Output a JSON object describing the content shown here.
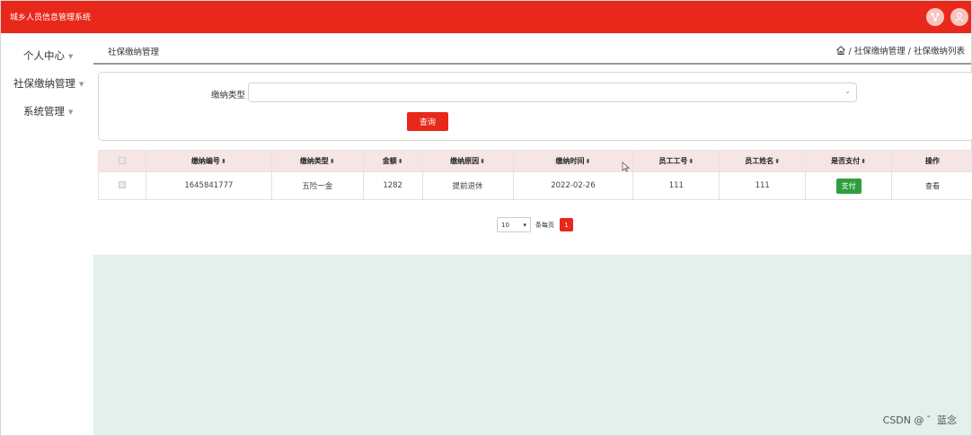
{
  "app": {
    "title": "城乡人员信息管理系统"
  },
  "sidebar": {
    "items": [
      {
        "label": "个人中心"
      },
      {
        "label": "社保缴纳管理"
      },
      {
        "label": "系统管理"
      }
    ]
  },
  "header": {
    "page_title": "社保缴纳管理",
    "breadcrumb": "/ 社保缴纳管理 / 社保缴纳列表"
  },
  "search": {
    "type_label": "缴纳类型",
    "type_value": "",
    "query_label": "查询"
  },
  "table": {
    "columns": [
      "缴纳编号",
      "缴纳类型",
      "金额",
      "缴纳原因",
      "缴纳时间",
      "员工工号",
      "员工姓名",
      "是否支付",
      "操作"
    ],
    "rows": [
      {
        "id": "1645841777",
        "type": "五险一金",
        "amount": "1282",
        "reason": "提前退休",
        "time": "2022-02-26",
        "emp_no": "111",
        "emp_name": "111",
        "pay_label": "支付",
        "action_label": "查看"
      }
    ]
  },
  "pagination": {
    "page_size": "10",
    "per_page_label": "条每页",
    "current_page": "1"
  },
  "watermark": "CSDN @ ゛蓝念",
  "colors": {
    "brand": "#e8281a",
    "pay": "#2f9e3e",
    "content_bg": "#e3f0ec",
    "table_header": "#f6e5e5"
  },
  "icons": [
    "network-icon",
    "user-icon",
    "home-icon",
    "chevron-down-icon",
    "sort-icon"
  ]
}
